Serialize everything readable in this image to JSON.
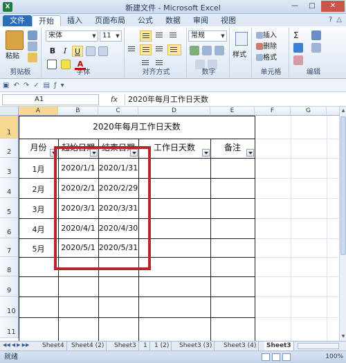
{
  "window": {
    "title": "新建文件 - Microsoft Excel"
  },
  "tabs": [
    "文件",
    "开始",
    "插入",
    "页面布局",
    "公式",
    "数据",
    "审阅",
    "视图"
  ],
  "ribbon": {
    "clipboard": {
      "paste": "粘贴",
      "label": "剪贴板"
    },
    "font": {
      "name": "宋体",
      "size": "11",
      "bold": "B",
      "italic": "I",
      "underline": "U",
      "font_color": "A",
      "label": "字体"
    },
    "alignment": {
      "label": "对齐方式"
    },
    "number": {
      "format": "常规",
      "label": "数字"
    },
    "styles": {
      "label": "样式"
    },
    "cells": {
      "insert": "插入",
      "delete": "删除",
      "format": "格式",
      "label": "单元格"
    },
    "editing": {
      "sum": "Σ",
      "label": "编辑"
    }
  },
  "formula_bar": {
    "name_box": "A1",
    "fx": "fx",
    "content": "2020年每月工作日天数"
  },
  "sheet": {
    "columns": [
      "A",
      "B",
      "C",
      "D",
      "E",
      "F",
      "G"
    ],
    "rows": [
      "1",
      "2",
      "3",
      "4",
      "5",
      "6",
      "7",
      "8",
      "9",
      "10",
      "11"
    ],
    "title": "2020年每月工作日天数",
    "headers": [
      "月份",
      "起始日期",
      "结束日期",
      "工作日天数",
      "备注"
    ],
    "data": [
      [
        "1月",
        "2020/1/1",
        "2020/1/31"
      ],
      [
        "2月",
        "2020/2/1",
        "2020/2/29"
      ],
      [
        "3月",
        "2020/3/1",
        "2020/3/31"
      ],
      [
        "4月",
        "2020/4/1",
        "2020/4/30"
      ],
      [
        "5月",
        "2020/5/1",
        "2020/5/31"
      ]
    ]
  },
  "sheet_tabs": [
    "Sheet4",
    "Sheet4 (2)",
    "Sheet3",
    "1",
    "1 (2)",
    "Sheet3 (3)",
    "Sheet3 (4)",
    "Sheet3"
  ],
  "status": {
    "ready": "就绪",
    "zoom": "100%"
  }
}
